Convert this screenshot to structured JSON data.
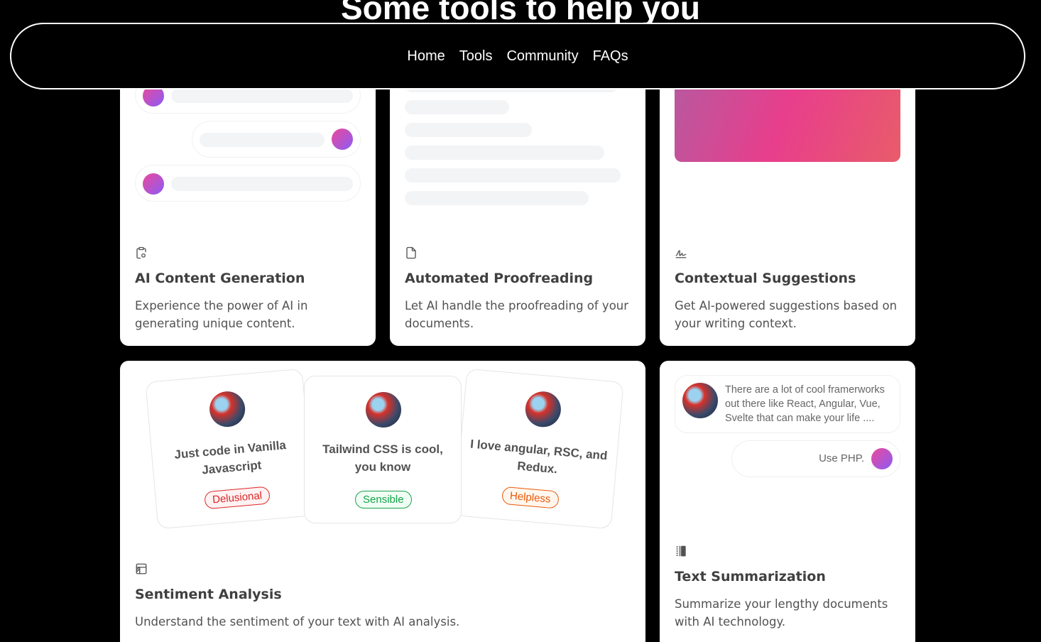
{
  "page": {
    "heading": "Some tools to help you"
  },
  "nav": {
    "items": [
      "Home",
      "Tools",
      "Community",
      "FAQs"
    ]
  },
  "cards": {
    "content_generation": {
      "title": "AI Content Generation",
      "description": "Experience the power of AI in generating unique content.",
      "icon": "clipboard-icon"
    },
    "proofreading": {
      "title": "Automated Proofreading",
      "description": "Let AI handle the proofreading of your documents.",
      "icon": "file-icon"
    },
    "suggestions": {
      "title": "Contextual Suggestions",
      "description": "Get AI-powered suggestions based on your writing context.",
      "icon": "signature-icon"
    },
    "sentiment": {
      "title": "Sentiment Analysis",
      "description": "Understand the sentiment of your text with AI analysis.",
      "icon": "table-icon",
      "reviews": [
        {
          "text": "Just code in Vanilla Javascript",
          "tag": "Delusional",
          "tag_color": "#dc2626"
        },
        {
          "text": "Tailwind CSS is cool, you know",
          "tag": "Sensible",
          "tag_color": "#16a34a"
        },
        {
          "text": "I love angular, RSC, and Redux.",
          "tag": "Helpless",
          "tag_color": "#ea580c"
        }
      ]
    },
    "summarization": {
      "title": "Text Summarization",
      "description": "Summarize your lengthy documents with AI technology.",
      "icon": "columns-icon",
      "message": "There are a lot of cool framerworks out there like React, Angular, Vue, Svelte that can make your life ....",
      "reply": "Use PHP."
    }
  },
  "colors": {
    "accent_gradient_start": "#ec4899",
    "accent_gradient_end": "#8b5cf6",
    "suggestion_gradient": "#e83e8c"
  }
}
